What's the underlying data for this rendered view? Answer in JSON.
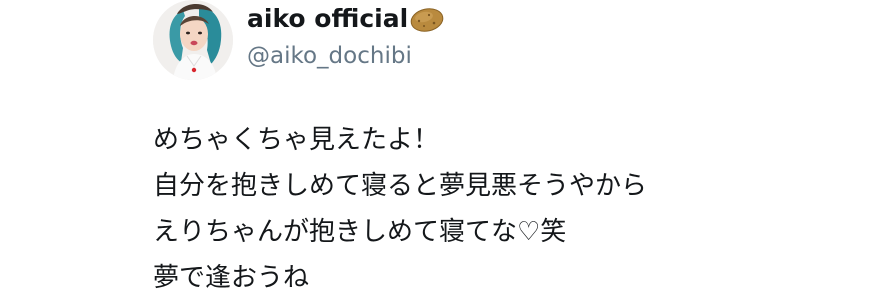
{
  "tweet": {
    "author": {
      "display_name": "aiko official",
      "name_emoji_icon": "potato-icon",
      "handle": "@aiko_dochibi",
      "avatar_icon": "profile-photo"
    },
    "text_lines": [
      "めちゃくちゃ見えたよ！",
      "自分を抱きしめて寝ると夢見悪そうやから",
      "えりちゃんが抱きしめて寝てな♡笑",
      "夢で逢おうね"
    ]
  },
  "colors": {
    "text_primary": "#14171a",
    "text_secondary": "#657786",
    "background": "#ffffff"
  }
}
